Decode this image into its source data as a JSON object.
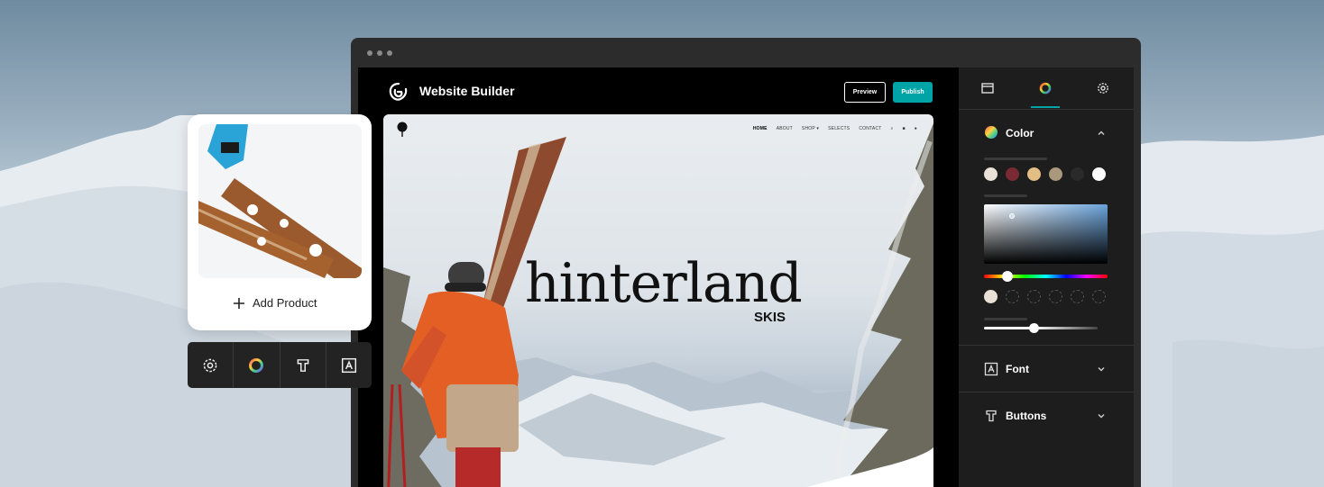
{
  "app": {
    "brand": "Website Builder",
    "preview_label": "Preview",
    "publish_label": "Publish",
    "accent": "#00a4a6"
  },
  "site": {
    "nav": [
      "HOME",
      "ABOUT",
      "SHOP",
      "SELECTS",
      "CONTACT"
    ],
    "hero_title": "hinterland",
    "hero_subtitle": "SKIS"
  },
  "panel": {
    "tabs": [
      "layout-icon",
      "color-wheel-icon",
      "gear-icon"
    ],
    "color": {
      "title": "Color",
      "swatches": [
        "#e9e1d6",
        "#7a2a33",
        "#e2bd84",
        "#a9987c",
        "#2a2a2a",
        "#ffffff"
      ],
      "picker_base": "#6aa3db"
    },
    "font": {
      "title": "Font"
    },
    "buttons": {
      "title": "Buttons"
    }
  },
  "card": {
    "add_product_label": "Add Product"
  }
}
